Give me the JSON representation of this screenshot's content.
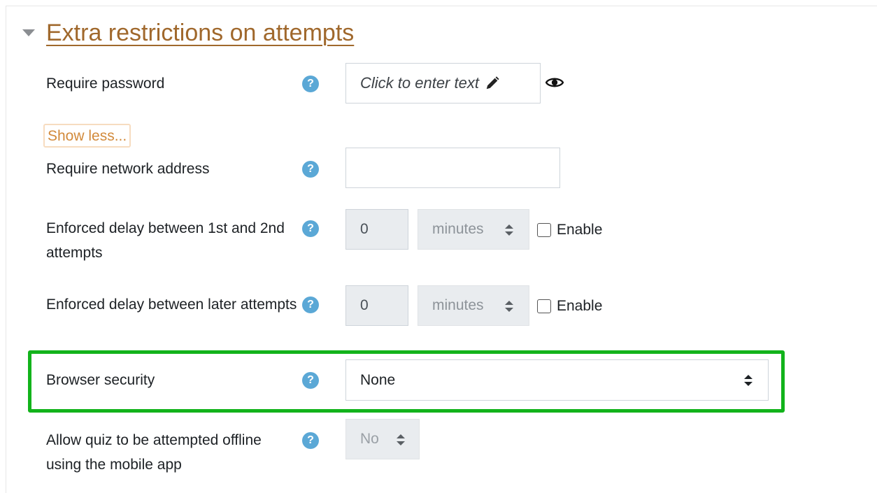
{
  "section": {
    "title": "Extra restrictions on attempts",
    "toggle_icon": "caret-down-icon"
  },
  "require_password": {
    "label": "Require password",
    "placeholder_text": "Click to enter text",
    "edit_icon": "pencil-icon",
    "reveal_icon": "eye-icon"
  },
  "show_less": {
    "label": "Show less..."
  },
  "network_address": {
    "label": "Require network address",
    "value": ""
  },
  "delay_first": {
    "label": "Enforced delay between 1st and 2nd attempts",
    "value": "0",
    "unit": "minutes",
    "enable_label": "Enable",
    "enabled": false
  },
  "delay_later": {
    "label": "Enforced delay between later attempts",
    "value": "0",
    "unit": "minutes",
    "enable_label": "Enable",
    "enabled": false
  },
  "browser_security": {
    "label": "Browser security",
    "selected": "None",
    "highlight_color": "#12b31b"
  },
  "offline": {
    "label": "Allow quiz to be attempted offline using the mobile app",
    "selected": "No"
  },
  "help_icon": "question-circle-icon",
  "help_symbol": "?",
  "colors": {
    "title": "#a0682c",
    "show_less": "#d28a3b",
    "help": "#5ba8d6"
  }
}
